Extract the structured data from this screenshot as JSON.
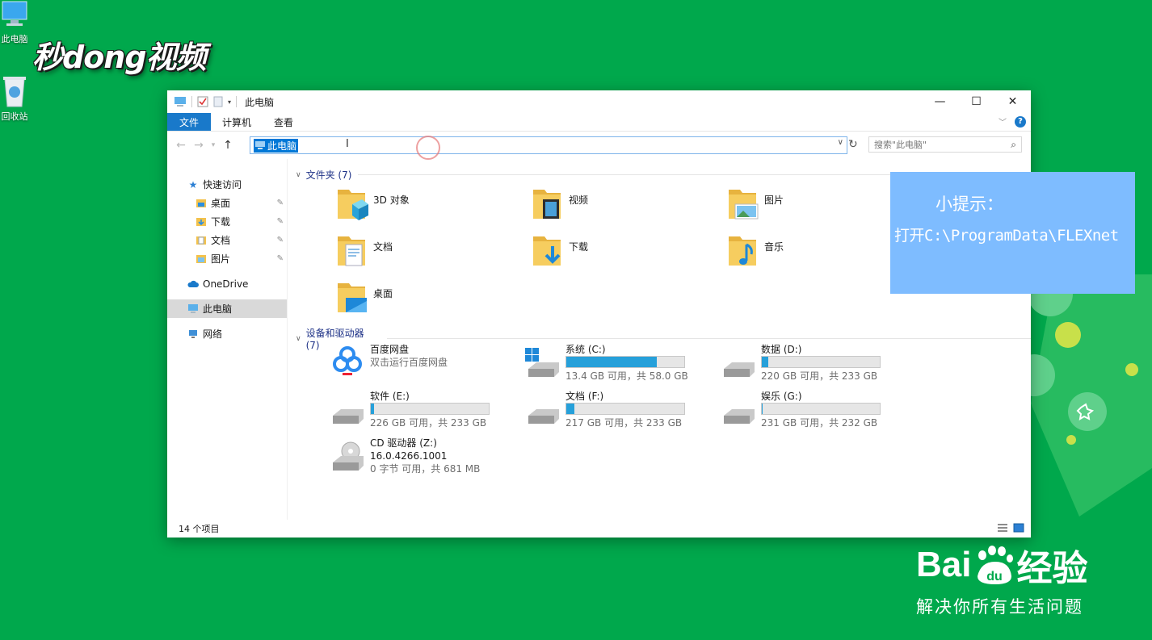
{
  "desktop": {
    "icons": [
      {
        "label": "此电脑",
        "icon": "computer-icon"
      },
      {
        "label": "回收站",
        "icon": "recycle-bin-icon"
      }
    ],
    "watermark": "秒dong视频"
  },
  "window": {
    "title": "此电脑",
    "controls": {
      "minimize": "—",
      "maximize": "☐",
      "close": "✕"
    },
    "ribbon_tabs": [
      "文件",
      "计算机",
      "查看"
    ],
    "address": "此电脑",
    "search_placeholder": "搜索\"此电脑\"",
    "sidebar": {
      "quick_access": "快速访问",
      "pinned": [
        "桌面",
        "下载",
        "文档",
        "图片"
      ],
      "onedrive": "OneDrive",
      "this_pc": "此电脑",
      "network": "网络"
    },
    "folders_header": "文件夹 (7)",
    "folders": [
      "3D 对象",
      "视频",
      "图片",
      "文档",
      "下载",
      "音乐",
      "桌面"
    ],
    "devices_header": "设备和驱动器 (7)",
    "baidu_disk": {
      "name": "百度网盘",
      "sub": "双击运行百度网盘"
    },
    "drives": [
      {
        "name": "系统 (C:)",
        "info": "13.4 GB 可用，共 58.0 GB",
        "used": 0.77
      },
      {
        "name": "数据 (D:)",
        "info": "220 GB 可用，共 233 GB",
        "used": 0.056
      },
      {
        "name": "软件 (E:)",
        "info": "226 GB 可用，共 233 GB",
        "used": 0.03
      },
      {
        "name": "文档 (F:)",
        "info": "217 GB 可用，共 233 GB",
        "used": 0.069
      },
      {
        "name": "娱乐 (G:)",
        "info": "231 GB 可用，共 232 GB",
        "used": 0.01
      }
    ],
    "cd_drive": {
      "name": "CD 驱动器 (Z:)",
      "label": "16.0.4266.1001",
      "info": "0 字节 可用，共 681 MB"
    },
    "status": "14 个项目"
  },
  "tip": {
    "title": "小提示：",
    "text": "打开C:\\ProgramData\\FLEXnet"
  },
  "baidu": {
    "brand": "Bai",
    "brand_suffix": "经验",
    "slogan": "解决你所有生活问题"
  },
  "colors": {
    "desktop": "#00a84c",
    "accent": "#1979ca",
    "tip": "#7ebcff",
    "bar": "#26a0da"
  }
}
